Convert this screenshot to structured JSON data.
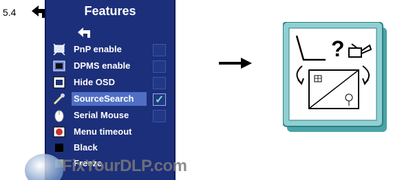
{
  "section_number": "5.4",
  "menu": {
    "title": "Features",
    "items": [
      {
        "label": "PnP enable",
        "icon": "pnp-icon",
        "checked": false,
        "selected": false
      },
      {
        "label": "DPMS enable",
        "icon": "dpms-icon",
        "checked": false,
        "selected": false
      },
      {
        "label": "Hide OSD",
        "icon": "hide-osd-icon",
        "checked": false,
        "selected": false
      },
      {
        "label": "SourceSearch",
        "icon": "source-search-icon",
        "checked": true,
        "selected": true
      },
      {
        "label": "Serial Mouse",
        "icon": "serial-mouse-icon",
        "checked": false,
        "selected": false
      },
      {
        "label": "Menu timeout",
        "icon": "menu-timeout-icon",
        "checked": false,
        "selected": false
      },
      {
        "label": "Black",
        "icon": "black-icon",
        "checked": false,
        "selected": false
      },
      {
        "label": "Freeze",
        "icon": "freeze-icon",
        "checked": false,
        "selected": false
      }
    ],
    "check_mark": "✓"
  },
  "diagram": {
    "question_mark": "?"
  },
  "watermark": {
    "text": "FixYourDLP.com"
  },
  "colors": {
    "menu_bg": "#1c2f7a",
    "highlight": "#4f6fc4",
    "check": "#7fd9b8",
    "diagram_frame": "#4aa3a6"
  }
}
